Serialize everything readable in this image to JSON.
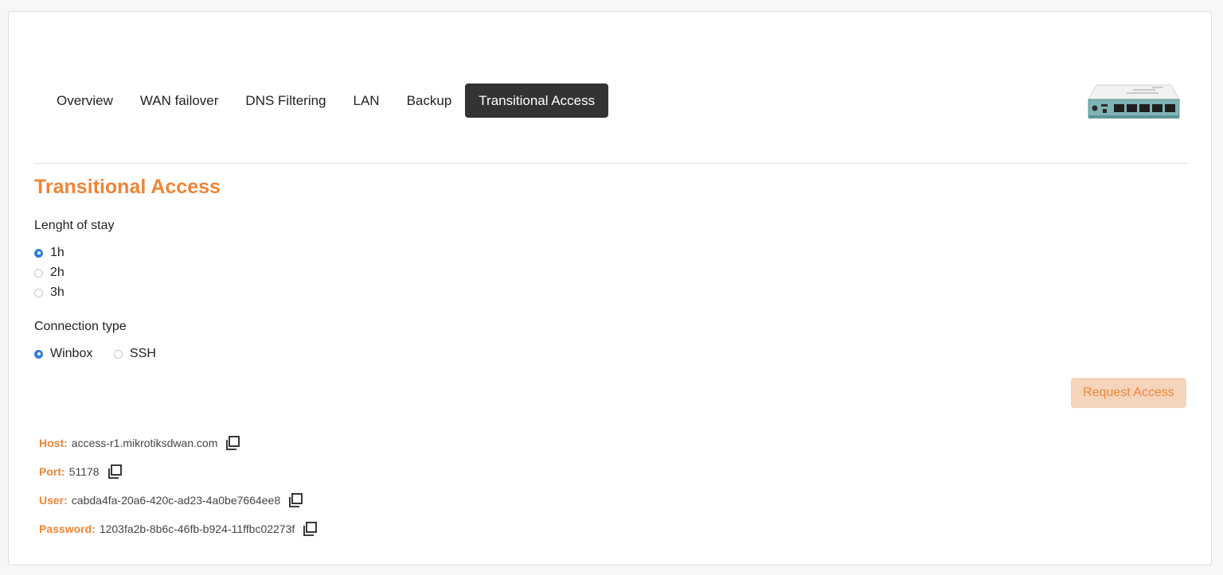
{
  "tabs": [
    {
      "label": "Overview",
      "active": false
    },
    {
      "label": "WAN failover",
      "active": false
    },
    {
      "label": "DNS Filtering",
      "active": false
    },
    {
      "label": "LAN",
      "active": false
    },
    {
      "label": "Backup",
      "active": false
    },
    {
      "label": "Transitional Access",
      "active": true
    }
  ],
  "page": {
    "title": "Transitional Access"
  },
  "stay": {
    "label": "Lenght of stay",
    "options": [
      {
        "label": "1h",
        "checked": true
      },
      {
        "label": "2h",
        "checked": false
      },
      {
        "label": "3h",
        "checked": false
      }
    ]
  },
  "connection": {
    "label": "Connection type",
    "options": [
      {
        "label": "Winbox",
        "checked": true
      },
      {
        "label": "SSH",
        "checked": false
      }
    ]
  },
  "request_button": "Request Access",
  "credentials": {
    "host": {
      "key": "Host:",
      "value": "access-r1.mikrotiksdwan.com"
    },
    "port": {
      "key": "Port:",
      "value": "51178"
    },
    "user": {
      "key": "User:",
      "value": "cabda4fa-20a6-420c-ad23-4a0be7664ee8"
    },
    "password": {
      "key": "Password:",
      "value": "1203fa2b-8b6c-46fb-b924-11ffbc02273f"
    }
  },
  "colors": {
    "accent": "#ef8535",
    "active_tab": "#333333",
    "radio_checked": "#2f7de1"
  },
  "icons": {
    "copy": "copy-icon",
    "device": "router-device-image"
  }
}
